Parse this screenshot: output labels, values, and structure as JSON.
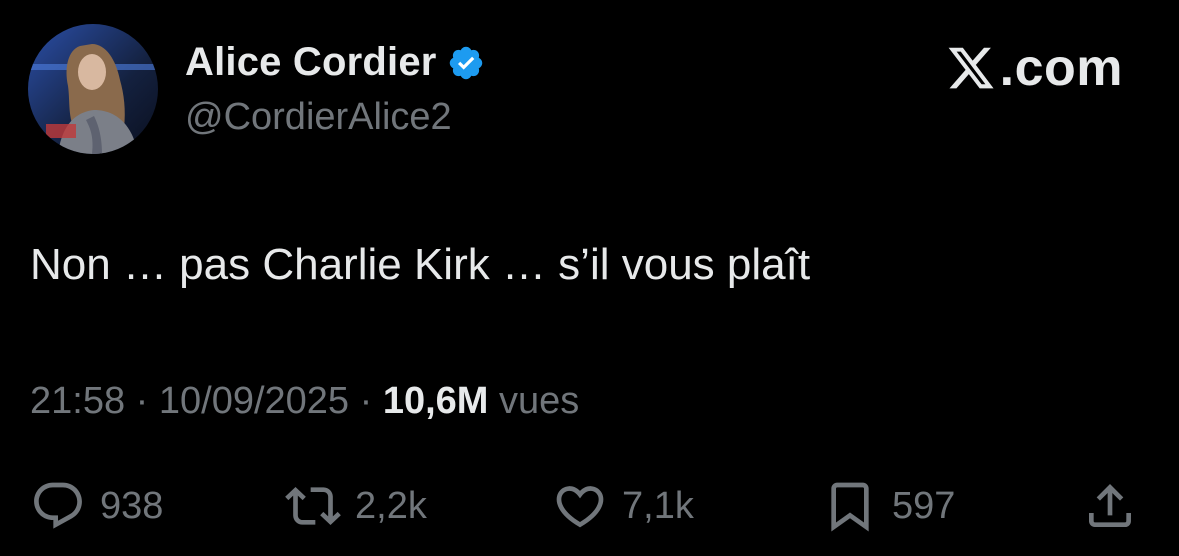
{
  "author": {
    "display_name": "Alice Cordier",
    "handle": "@CordierAlice2",
    "verified": true
  },
  "brand": {
    "label": ".com",
    "icon": "x-logo-icon"
  },
  "tweet": {
    "text": "Non … pas Charlie Kirk … s’il vous plaît",
    "time": "21:58",
    "date": "10/09/2025",
    "separator": "·",
    "views_count": "10,6M",
    "views_label": "vues"
  },
  "actions": {
    "replies": "938",
    "reposts": "2,2k",
    "likes": "7,1k",
    "bookmarks": "597"
  },
  "colors": {
    "background": "#000000",
    "primary_text": "#e7e9ea",
    "secondary_text": "#71767b",
    "verified_blue": "#1d9bf0"
  }
}
